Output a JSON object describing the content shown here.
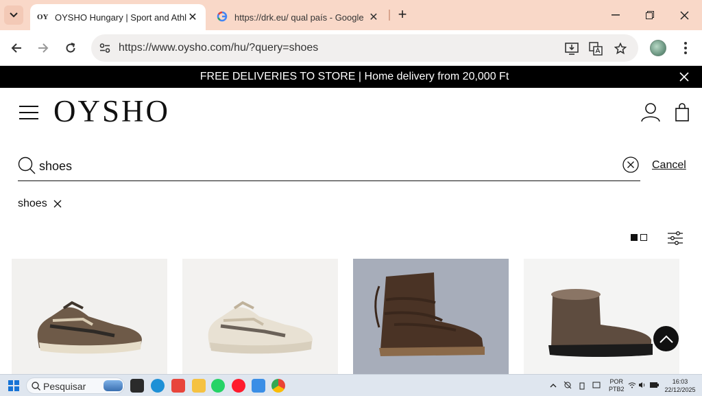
{
  "browser": {
    "tabs": [
      {
        "label": "OYSHO Hungary | Sport and Athle",
        "favicon": "OY",
        "active": true
      },
      {
        "label": "https://drk.eu/ qual país - Google",
        "favicon": "google-icon",
        "active": false
      }
    ],
    "url": "https://www.oysho.com/hu/?query=shoes"
  },
  "banner": {
    "text": "FREE DELIVERIES TO STORE | Home delivery from 20,000 Ft"
  },
  "site": {
    "logo": "OYSHO"
  },
  "search": {
    "query": "shoes",
    "cancel_label": "Cancel",
    "chip": "shoes"
  },
  "products": [
    {
      "name": "brown-metallic-sneaker",
      "bg": "#f2f1ef"
    },
    {
      "name": "cream-sneaker",
      "bg": "#f3f2f0"
    },
    {
      "name": "brown-suede-lace-boot",
      "bg": "#a7adba"
    },
    {
      "name": "brown-shearling-ankle-boot",
      "bg": "#f4f4f3"
    }
  ],
  "taskbar": {
    "search_label": "Pesquisar",
    "lang_top": "POR",
    "lang_bottom": "PTB2",
    "time": "16:03",
    "date": "22/12/2025"
  },
  "colors": {
    "tabbar": "#f9d8c8",
    "banner": "#000000",
    "accent": "#111111"
  }
}
